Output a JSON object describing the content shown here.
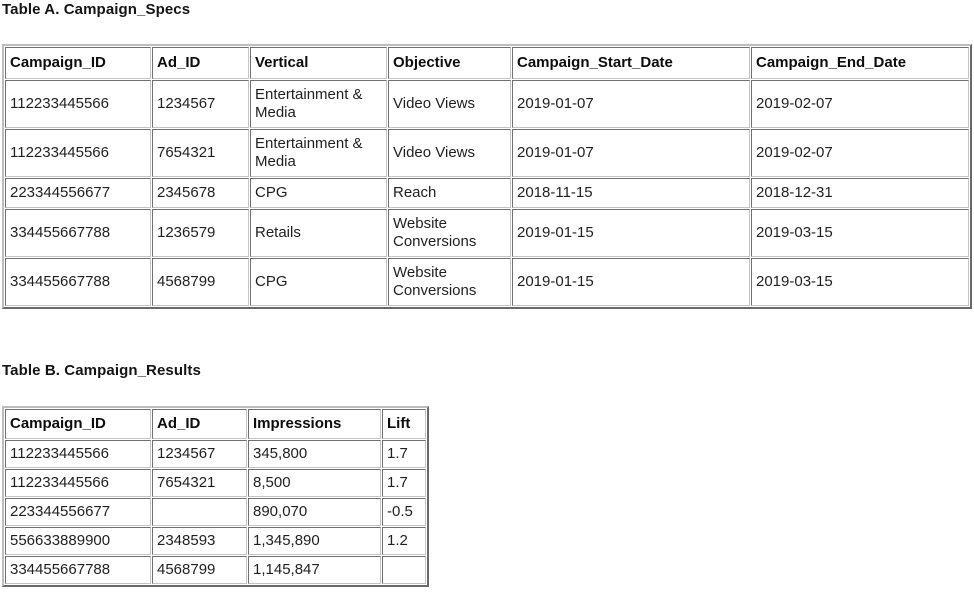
{
  "page": {
    "background_color": "#ffffff",
    "text_color": "#1f1f1f",
    "border_color": "#c4c4c4"
  },
  "table_a": {
    "title": "Table A. Campaign_Specs",
    "name": "Campaign_Specs",
    "columns": [
      "Campaign_ID",
      "Ad_ID",
      "Vertical",
      "Objective",
      "Campaign_Start_Date",
      "Campaign_End_Date"
    ],
    "rows": [
      {
        "Campaign_ID": "112233445566",
        "Ad_ID": "1234567",
        "Vertical": "Entertainment & Media",
        "Objective": "Video Views",
        "Campaign_Start_Date": "2019-01-07",
        "Campaign_End_Date": "2019-02-07"
      },
      {
        "Campaign_ID": "112233445566",
        "Ad_ID": "7654321",
        "Vertical": "Entertainment & Media",
        "Objective": "Video Views",
        "Campaign_Start_Date": "2019-01-07",
        "Campaign_End_Date": "2019-02-07"
      },
      {
        "Campaign_ID": "223344556677",
        "Ad_ID": "2345678",
        "Vertical": "CPG",
        "Objective": "Reach",
        "Campaign_Start_Date": "2018-11-15",
        "Campaign_End_Date": "2018-12-31"
      },
      {
        "Campaign_ID": "334455667788",
        "Ad_ID": "1236579",
        "Vertical": "Retails",
        "Objective": "Website Conversions",
        "Campaign_Start_Date": "2019-01-15",
        "Campaign_End_Date": "2019-03-15"
      },
      {
        "Campaign_ID": "334455667788",
        "Ad_ID": "4568799",
        "Vertical": "CPG",
        "Objective": "Website Conversions",
        "Campaign_Start_Date": "2019-01-15",
        "Campaign_End_Date": "2019-03-15"
      }
    ]
  },
  "table_b": {
    "title": "Table B. Campaign_Results",
    "name": "Campaign_Results",
    "columns": [
      "Campaign_ID",
      "Ad_ID",
      "Impressions",
      "Lift"
    ],
    "rows": [
      {
        "Campaign_ID": "112233445566",
        "Ad_ID": "1234567",
        "Impressions": "345,800",
        "Lift": "1.7"
      },
      {
        "Campaign_ID": "112233445566",
        "Ad_ID": "7654321",
        "Impressions": "8,500",
        "Lift": "1.7"
      },
      {
        "Campaign_ID": "223344556677",
        "Ad_ID": "",
        "Impressions": "890,070",
        "Lift": "-0.5"
      },
      {
        "Campaign_ID": "556633889900",
        "Ad_ID": "2348593",
        "Impressions": "1,345,890",
        "Lift": "1.2"
      },
      {
        "Campaign_ID": "334455667788",
        "Ad_ID": "4568799",
        "Impressions": "1,145,847",
        "Lift": ""
      }
    ]
  }
}
